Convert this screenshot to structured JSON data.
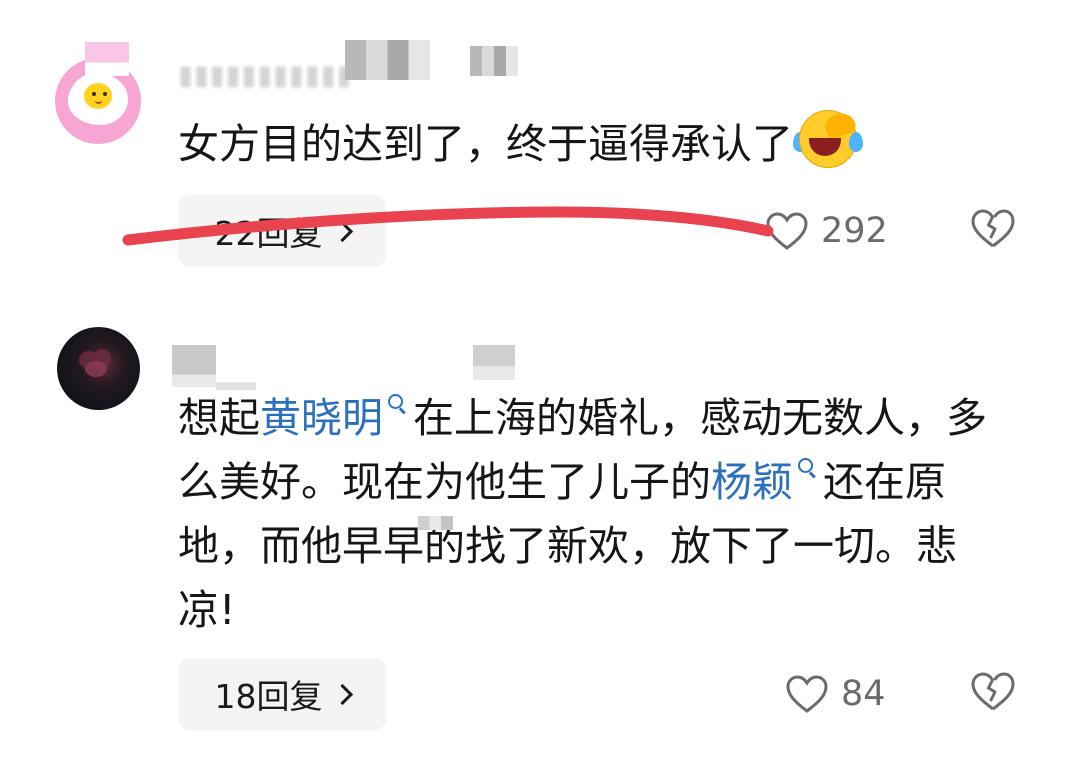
{
  "comments": [
    {
      "text_before_emoji": "女方目的达到了，终于逼得承认了",
      "emoji": "laughing-crying-emoji",
      "reply_label": "22回复",
      "like_count": "292"
    },
    {
      "text_part1": "想起",
      "link1": "黄晓明",
      "text_part2": "在上海的婚礼，感动无数人，多么美好。现在为他生了儿子的",
      "link2": "杨颖",
      "text_part3": "还在原地，而他早早的找了新欢，放下了一切。悲凉!",
      "reply_label": "18回复",
      "like_count": "84"
    }
  ],
  "colors": {
    "link": "#2c6fbd",
    "annotation": "#e8434f",
    "pill_bg": "#f4f4f4",
    "count_gray": "#6b6b6b"
  },
  "icons": {
    "like": "heart-outline-icon",
    "dislike": "broken-heart-icon",
    "expand": "chevron-right-icon",
    "search": "search-icon"
  }
}
